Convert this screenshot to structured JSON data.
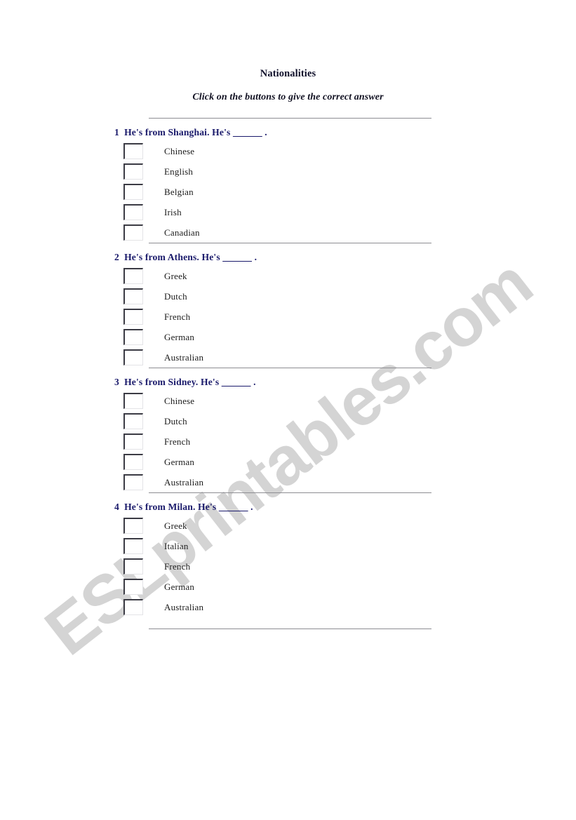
{
  "document": {
    "title": "Nationalities",
    "instructions": "Click on the buttons to give  the  correct answer"
  },
  "watermark": {
    "text": "ESLprintables.com",
    "color": "#d4d4d4",
    "rotation_deg": -38
  },
  "colors": {
    "question_text": "#1a1a6b",
    "option_text": "#1b1b1b",
    "rule": "#8d8d92",
    "checkbox_shadow": "#3b3b44",
    "page_background": "#ffffff"
  },
  "questions": [
    {
      "number": "1",
      "prompt": "He's from Shanghai. He's ",
      "blank": "______",
      "punctuation": " .",
      "options": [
        {
          "label": "Chinese",
          "checked": false
        },
        {
          "label": "English",
          "checked": false
        },
        {
          "label": "Belgian",
          "checked": false
        },
        {
          "label": "Irish",
          "checked": false
        },
        {
          "label": "Canadian",
          "checked": false
        }
      ]
    },
    {
      "number": "2",
      "prompt": "He's from Athens. He's ",
      "blank": "______",
      "punctuation": " .",
      "options": [
        {
          "label": "Greek",
          "checked": false
        },
        {
          "label": "Dutch",
          "checked": false
        },
        {
          "label": "French",
          "checked": false
        },
        {
          "label": "German",
          "checked": false
        },
        {
          "label": "Australian",
          "checked": false
        }
      ]
    },
    {
      "number": "3",
      "prompt": "He's from Sidney. He's ",
      "blank": "______",
      "punctuation": " .",
      "options": [
        {
          "label": "Chinese",
          "checked": false
        },
        {
          "label": "Dutch",
          "checked": false
        },
        {
          "label": "French",
          "checked": false
        },
        {
          "label": "German",
          "checked": false
        },
        {
          "label": "Australian",
          "checked": false
        }
      ]
    },
    {
      "number": "4",
      "prompt": "He's from Milan. He's ",
      "blank": "______",
      "punctuation": " .",
      "options": [
        {
          "label": "Greek",
          "checked": false
        },
        {
          "label": "Italian",
          "checked": false
        },
        {
          "label": "French",
          "checked": false
        },
        {
          "label": "German",
          "checked": false
        },
        {
          "label": "Australian",
          "checked": false
        }
      ]
    }
  ]
}
